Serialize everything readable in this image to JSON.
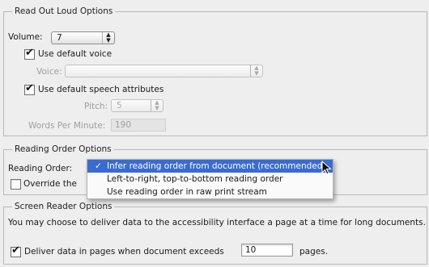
{
  "read_out_loud": {
    "title": "Read Out Loud Options",
    "volume_label": "Volume:",
    "volume_value": "7",
    "use_default_voice": "Use default voice",
    "voice_label": "Voice:",
    "voice_value": "",
    "use_default_speech": "Use default speech attributes",
    "pitch_label": "Pitch:",
    "pitch_value": "5",
    "wpm_label": "Words Per Minute:",
    "wpm_value": "190"
  },
  "reading_order": {
    "title": "Reading Order Options",
    "label": "Reading Order:",
    "override_label": "Override the",
    "menu_items": [
      "Infer reading order from document (recommended)",
      "Left-to-right, top-to-bottom reading order",
      "Use reading order in raw print stream"
    ],
    "selected_index": 0
  },
  "screen_reader": {
    "title": "Screen Reader Options",
    "description": "You may choose to deliver data to the accessibility interface a page at a time for long documents.",
    "deliver_label": "Deliver data in pages when document exceeds",
    "deliver_value": "10",
    "pages_suffix": "pages."
  },
  "icons": {
    "check": "checkmark-icon",
    "arrows": "up-down-arrows-icon",
    "cursor": "mouse-pointer-icon"
  }
}
